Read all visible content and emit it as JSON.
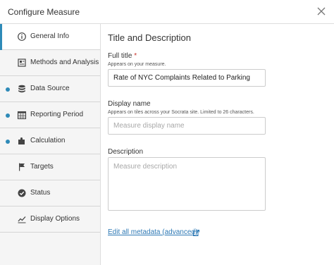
{
  "dialog": {
    "title": "Configure Measure"
  },
  "sidebar": {
    "items": [
      {
        "label": "General Info",
        "icon": "info-icon",
        "active": true,
        "dot": false
      },
      {
        "label": "Methods and Analysis",
        "icon": "document-icon",
        "active": false,
        "dot": false
      },
      {
        "label": "Data Source",
        "icon": "database-icon",
        "active": false,
        "dot": true
      },
      {
        "label": "Reporting Period",
        "icon": "calendar-icon",
        "active": false,
        "dot": true
      },
      {
        "label": "Calculation",
        "icon": "puzzle-icon",
        "active": false,
        "dot": true
      },
      {
        "label": "Targets",
        "icon": "flag-icon",
        "active": false,
        "dot": false
      },
      {
        "label": "Status",
        "icon": "check-circle-icon",
        "active": false,
        "dot": false
      },
      {
        "label": "Display Options",
        "icon": "line-chart-icon",
        "active": false,
        "dot": false
      }
    ]
  },
  "main": {
    "section_title": "Title and Description",
    "full_title": {
      "label": "Full title",
      "required_mark": "*",
      "help": "Appears on your measure.",
      "value": "Rate of NYC Complaints Related to Parking",
      "placeholder": ""
    },
    "display_name": {
      "label": "Display name",
      "help": "Appears on tiles across your Socrata site. Limited to 26 characters.",
      "value": "",
      "placeholder": "Measure display name"
    },
    "description": {
      "label": "Description",
      "value": "",
      "placeholder": "Measure description"
    },
    "metadata_link": "Edit all metadata (advanced)"
  },
  "colors": {
    "accent": "#2e8ab8",
    "link": "#2e79b5",
    "required": "#c8322a",
    "sidebar_bg": "#f5f5f5"
  }
}
